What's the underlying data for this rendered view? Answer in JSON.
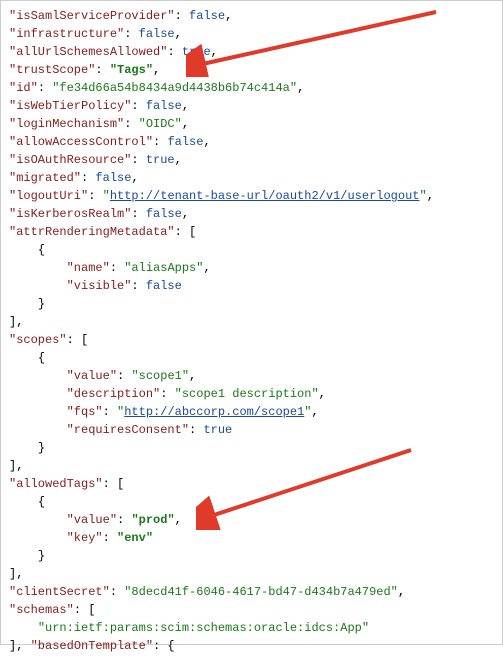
{
  "line1": {
    "key": "\"isSamlServiceProvider\"",
    "colon": ": ",
    "val": "false",
    "tail": ","
  },
  "line2": {
    "key": "\"infrastructure\"",
    "colon": ": ",
    "val": "false",
    "tail": ","
  },
  "line3": {
    "key": "\"allUrlSchemesAllowed\"",
    "colon": ": ",
    "val": "true",
    "tail": ","
  },
  "line4": {
    "key": "\"trustScope\"",
    "colon": ": ",
    "val": "\"Tags\"",
    "tail": ","
  },
  "line5": {
    "key": "\"id\"",
    "colon": ": ",
    "val": "\"fe34d66a54b8434a9d4438b6b74c414a\"",
    "tail": ","
  },
  "line6": {
    "key": "\"isWebTierPolicy\"",
    "colon": ": ",
    "val": "false",
    "tail": ","
  },
  "line7": {
    "key": "\"loginMechanism\"",
    "colon": ": ",
    "val": "\"OIDC\"",
    "tail": ","
  },
  "line8": {
    "key": "\"allowAccessControl\"",
    "colon": ": ",
    "val": "false",
    "tail": ","
  },
  "line9": {
    "key": "\"isOAuthResource\"",
    "colon": ": ",
    "val": "true",
    "tail": ","
  },
  "line10": {
    "key": "\"migrated\"",
    "colon": ": ",
    "val": "false",
    "tail": ","
  },
  "line11": {
    "key": "\"logoutUri\"",
    "colon": ": ",
    "q": "\"",
    "val": "http://tenant-base-url/oauth2/v1/userlogout",
    "q2": "\"",
    "tail": ","
  },
  "line12": {
    "key": "\"isKerberosRealm\"",
    "colon": ": ",
    "val": "false",
    "tail": ","
  },
  "line13": {
    "key": "\"attrRenderingMetadata\"",
    "colon": ": ["
  },
  "line14": {
    "open": "{"
  },
  "line15": {
    "key": "\"name\"",
    "colon": ": ",
    "val": "\"aliasApps\"",
    "tail": ","
  },
  "line16": {
    "key": "\"visible\"",
    "colon": ": ",
    "val": "false"
  },
  "line17": {
    "close": "}"
  },
  "line18": {
    "close": "],"
  },
  "line19": {
    "key": "\"scopes\"",
    "colon": ": ["
  },
  "line20": {
    "open": "{"
  },
  "line21": {
    "key": "\"value\"",
    "colon": ": ",
    "val": "\"scope1\"",
    "tail": ","
  },
  "line22": {
    "key": "\"description\"",
    "colon": ": ",
    "val": "\"scope1 description\"",
    "tail": ","
  },
  "line23": {
    "key": "\"fqs\"",
    "colon": ": ",
    "q": "\"",
    "val": "http://abccorp.com/scope1",
    "q2": "\"",
    "tail": ","
  },
  "line24": {
    "key": "\"requiresConsent\"",
    "colon": ": ",
    "val": "true"
  },
  "line25": {
    "close": "}"
  },
  "line26": {
    "close": "],"
  },
  "line27": {
    "key": "\"allowedTags\"",
    "colon": ": ["
  },
  "line28": {
    "open": "{"
  },
  "line29": {
    "key": "\"value\"",
    "colon": ": ",
    "val": "\"prod\"",
    "tail": ","
  },
  "line30": {
    "key": "\"key\"",
    "colon": ": ",
    "val": "\"env\""
  },
  "line31": {
    "close": "}"
  },
  "line32": {
    "close": "],"
  },
  "line33": {
    "key": "\"clientSecret\"",
    "colon": ": ",
    "val": "\"8decd41f-6046-4617-bd47-d434b7a479ed\"",
    "tail": ","
  },
  "line34": {
    "key": "\"schemas\"",
    "colon": ": ["
  },
  "line35": {
    "val": "\"urn:ietf:params:scim:schemas:oracle:idcs:App\""
  },
  "line36": {
    "close": "], ",
    "key": "\"basedOnTemplate\"",
    "colon": ": {"
  }
}
